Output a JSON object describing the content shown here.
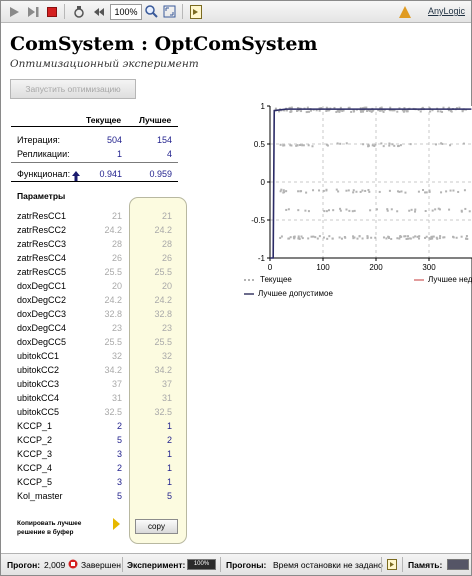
{
  "toolbar": {
    "zoom": "100%",
    "brand": "AnyLogic"
  },
  "header": {
    "title": "ComSystem : OptComSystem",
    "subtitle": "Оптимизационный эксперимент"
  },
  "run_button_label": "Запустить оптимизацию",
  "stats": {
    "col_current": "Текущее",
    "col_best": "Лучшее",
    "iteration_label": "Итерация:",
    "iteration_current": "504",
    "iteration_best": "154",
    "replication_label": "Репликации:",
    "replication_current": "1",
    "replication_best": "4",
    "functional_label": "Функционал:",
    "functional_current": "0.941",
    "functional_best": "0.959"
  },
  "params_title": "Параметры",
  "params": [
    {
      "name": "zatrResCC1",
      "current": "21",
      "best": "21",
      "enabled": false
    },
    {
      "name": "zatrResCC2",
      "current": "24.2",
      "best": "24.2",
      "enabled": false
    },
    {
      "name": "zatrResCC3",
      "current": "28",
      "best": "28",
      "enabled": false
    },
    {
      "name": "zatrResCC4",
      "current": "26",
      "best": "26",
      "enabled": false
    },
    {
      "name": "zatrResCC5",
      "current": "25.5",
      "best": "25.5",
      "enabled": false
    },
    {
      "name": "doxDegCC1",
      "current": "20",
      "best": "20",
      "enabled": false
    },
    {
      "name": "doxDegCC2",
      "current": "24.2",
      "best": "24.2",
      "enabled": false
    },
    {
      "name": "doxDegCC3",
      "current": "32.8",
      "best": "32.8",
      "enabled": false
    },
    {
      "name": "doxDegCC4",
      "current": "23",
      "best": "23",
      "enabled": false
    },
    {
      "name": "doxDegCC5",
      "current": "25.5",
      "best": "25.5",
      "enabled": false
    },
    {
      "name": "ubitokCC1",
      "current": "32",
      "best": "32",
      "enabled": false
    },
    {
      "name": "ubitokCC2",
      "current": "34.2",
      "best": "34.2",
      "enabled": false
    },
    {
      "name": "ubitokCC3",
      "current": "37",
      "best": "37",
      "enabled": false
    },
    {
      "name": "ubitokCC4",
      "current": "31",
      "best": "31",
      "enabled": false
    },
    {
      "name": "ubitokCC5",
      "current": "32.5",
      "best": "32.5",
      "enabled": false
    },
    {
      "name": "KCCP_1",
      "current": "2",
      "best": "1",
      "enabled": true
    },
    {
      "name": "KCCP_2",
      "current": "5",
      "best": "2",
      "enabled": true
    },
    {
      "name": "KCCP_3",
      "current": "3",
      "best": "1",
      "enabled": true
    },
    {
      "name": "KCCP_4",
      "current": "2",
      "best": "1",
      "enabled": true
    },
    {
      "name": "KCCP_5",
      "current": "3",
      "best": "1",
      "enabled": true
    },
    {
      "name": "Kol_master",
      "current": "5",
      "best": "5",
      "enabled": true
    }
  ],
  "copy": {
    "label_line1": "Копировать лучшее",
    "label_line2": "решение в буфер",
    "button": "copy"
  },
  "chart_data": {
    "type": "scatter",
    "xlim": [
      0,
      380
    ],
    "ylim": [
      -1,
      1
    ],
    "x_ticks": [
      "0",
      "100",
      "200",
      "300"
    ],
    "y_ticks": [
      "1",
      "0.5",
      "0",
      "-0.5",
      "-1"
    ],
    "grid": true,
    "legend": [
      {
        "name": "Текущее",
        "color": "#b3b3b3"
      },
      {
        "name": "Лучшее недопустимое",
        "color": "#d87a7a"
      },
      {
        "name": "Лучшее допустимое",
        "color": "#3a3a66"
      }
    ],
    "series": [
      {
        "name": "Лучшее допустимое",
        "x": [
          0,
          6,
          8,
          30,
          380
        ],
        "y": [
          -1,
          -1,
          0.94,
          0.959,
          0.959
        ]
      },
      {
        "name": "Текущее",
        "bands": [
          {
            "y": 0.95,
            "spread": 0.03,
            "from": 8,
            "to": 380,
            "count": 150
          },
          {
            "y": 0.49,
            "spread": 0.02,
            "from": 20,
            "to": 380,
            "count": 40
          },
          {
            "y": -0.12,
            "spread": 0.02,
            "from": 20,
            "to": 380,
            "count": 45
          },
          {
            "y": -0.37,
            "spread": 0.02,
            "from": 20,
            "to": 380,
            "count": 35
          },
          {
            "y": -0.73,
            "spread": 0.02,
            "from": 10,
            "to": 380,
            "count": 90
          }
        ]
      }
    ]
  },
  "status": {
    "run_label": "Прогон:",
    "run_value": "2,009",
    "state": "Завершен",
    "experiment_label": "Эксперимент:",
    "experiment_progress": "100%",
    "runs_label": "Прогоны:",
    "runs_value": "Время остановки не задано",
    "memory_label": "Память:"
  }
}
